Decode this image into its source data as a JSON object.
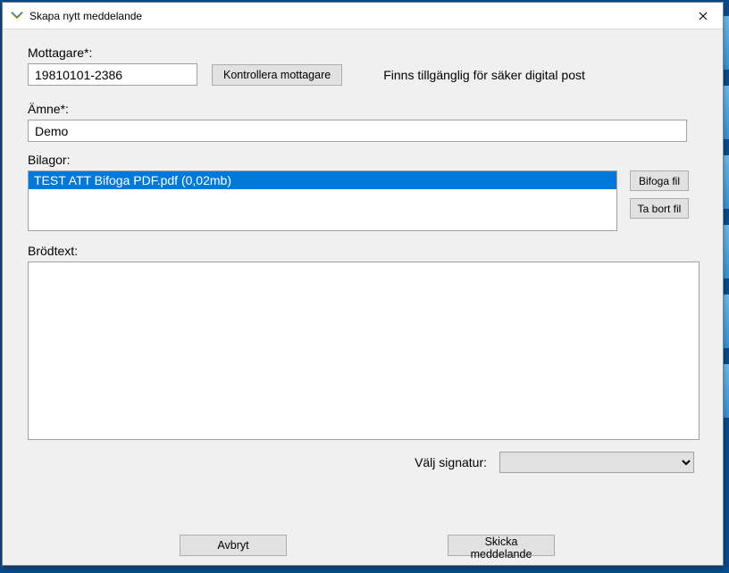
{
  "window": {
    "title": "Skapa nytt meddelande"
  },
  "recipient": {
    "label": "Mottagare*:",
    "value": "19810101-2386",
    "check_button": "Kontrollera mottagare",
    "status": "Finns tillgänglig för säker digital post"
  },
  "subject": {
    "label": "Ämne*:",
    "value": "Demo"
  },
  "attachments": {
    "label": "Bilagor:",
    "items": [
      {
        "name": "TEST ATT Bifoga PDF.pdf (0,02mb)",
        "selected": true
      }
    ],
    "attach_button": "Bifoga fil",
    "remove_button": "Ta bort fil"
  },
  "body": {
    "label": "Brödtext:",
    "value": ""
  },
  "signature": {
    "label": "Välj signatur:",
    "selected": "",
    "options": []
  },
  "footer": {
    "cancel": "Avbryt",
    "send": "Skicka meddelande"
  },
  "colors": {
    "selection": "#0078d7",
    "panel": "#f0f0f0"
  }
}
